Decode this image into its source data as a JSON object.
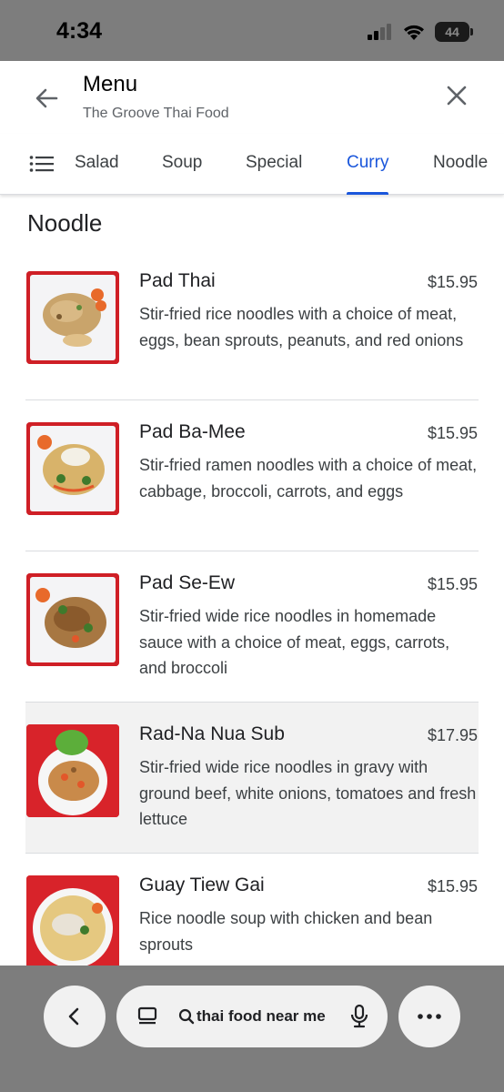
{
  "status_bar": {
    "time": "4:34",
    "battery": "44",
    "icons": [
      "signal-icon",
      "wifi-icon",
      "battery-icon"
    ]
  },
  "header": {
    "title": "Menu",
    "subtitle": "The Groove Thai Food",
    "back_icon": "arrow-back-icon",
    "close_icon": "close-icon"
  },
  "tabs": {
    "menu_icon": "list-icon",
    "items": [
      {
        "label": "Salad",
        "active": false
      },
      {
        "label": "Soup",
        "active": false
      },
      {
        "label": "Special",
        "active": false
      },
      {
        "label": "Curry",
        "active": true
      },
      {
        "label": "Noodle",
        "active": false
      }
    ],
    "accent_color": "#1a56db"
  },
  "section": {
    "title": "Noodle"
  },
  "items": [
    {
      "name": "Pad Thai",
      "price": "$15.95",
      "description": "Stir-fried rice noodles with a choice of meat, eggs, bean sprouts, peanuts, and red onions"
    },
    {
      "name": "Pad Ba-Mee",
      "price": "$15.95",
      "description": "Stir-fried ramen noodles with a choice of meat, cabbage, broccoli, carrots, and eggs"
    },
    {
      "name": "Pad Se-Ew",
      "price": "$15.95",
      "description": "Stir-fried wide rice noodles in homemade sauce with a choice of meat, eggs, carrots, and broccoli"
    },
    {
      "name": "Rad-Na Nua Sub",
      "price": "$17.95",
      "description": "Stir-fried wide rice noodles in gravy with ground beef, white onions, tomatoes and fresh lettuce"
    },
    {
      "name": "Guay Tiew Gai",
      "price": "$15.95",
      "description": "Rice noodle soup with chicken and bean sprouts"
    }
  ],
  "bottom_bar": {
    "search_query": "thai food near me",
    "icons": [
      "chevron-left-icon",
      "tabs-icon",
      "search-icon",
      "mic-icon",
      "more-icon"
    ]
  }
}
